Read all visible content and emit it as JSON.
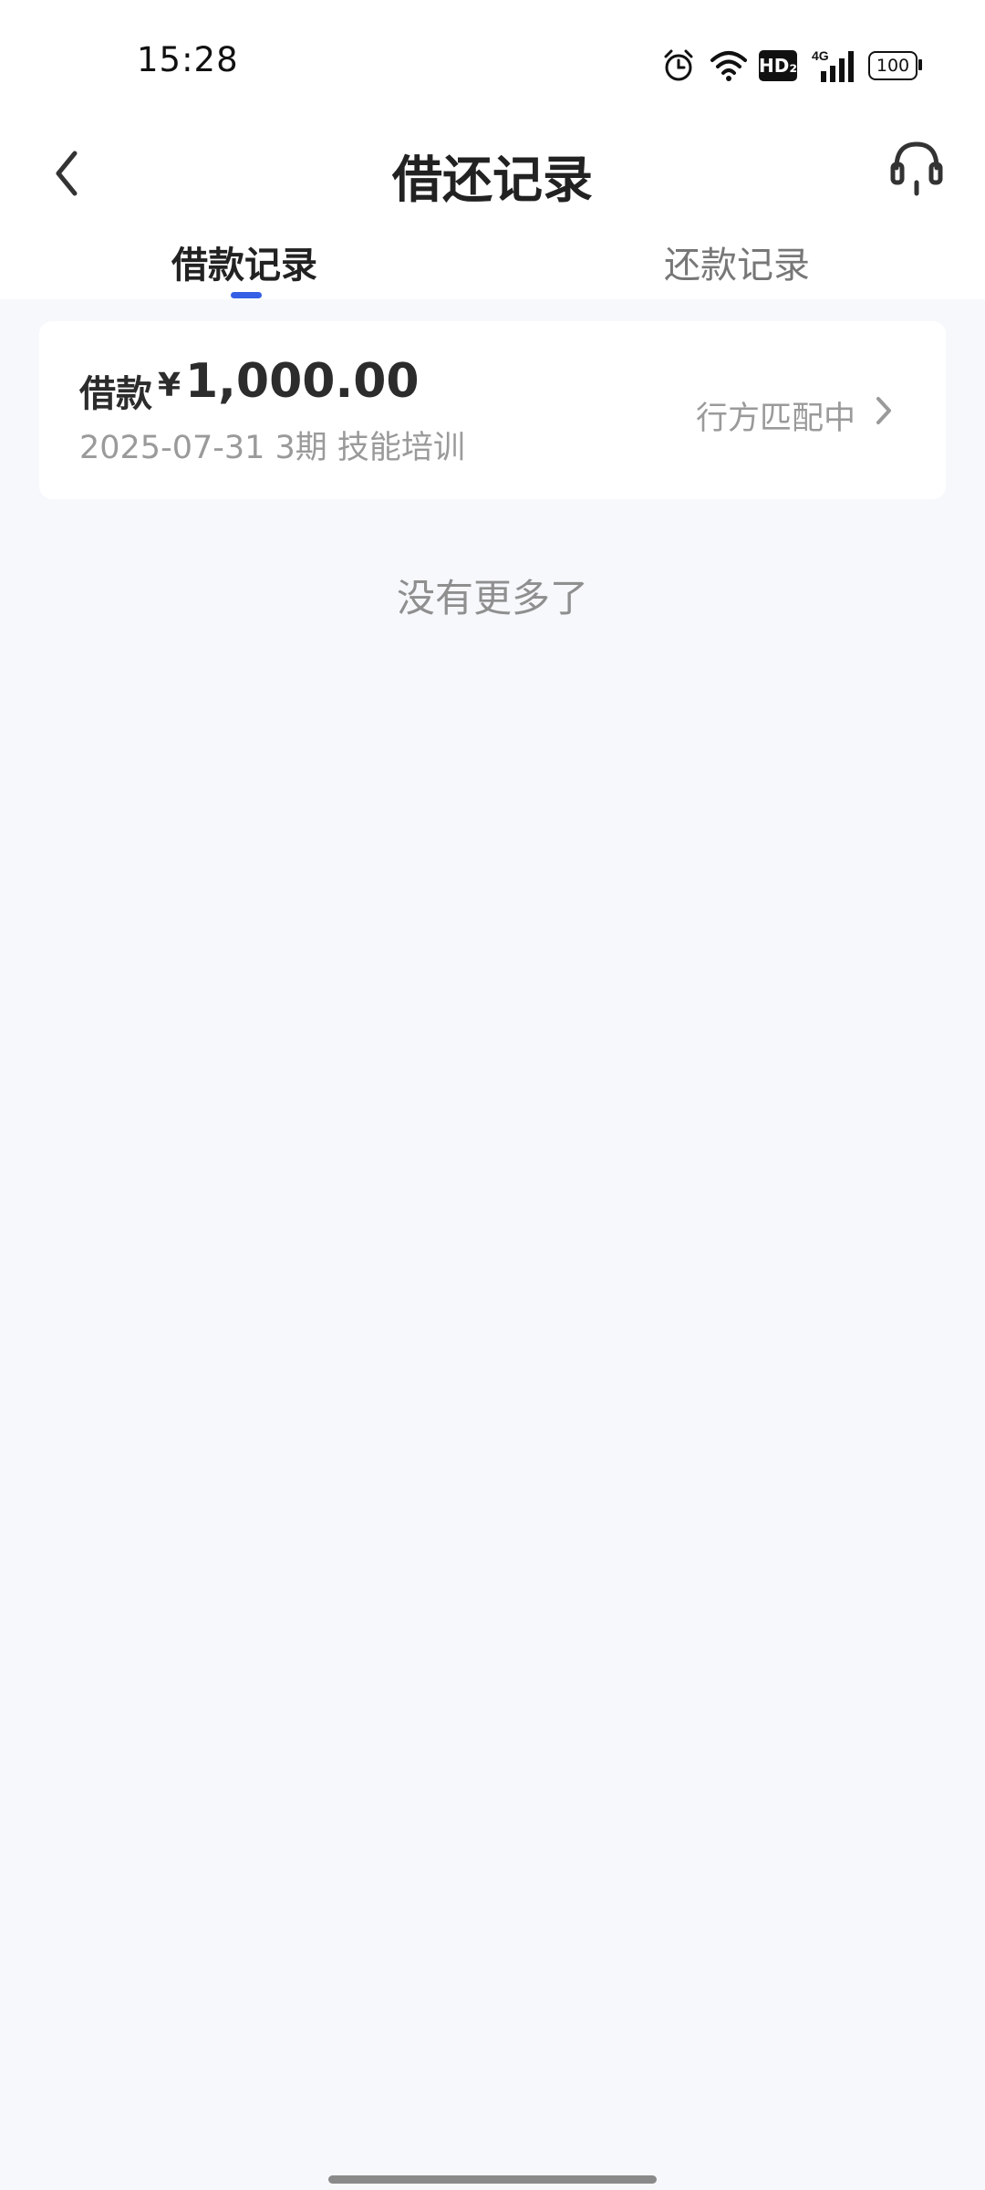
{
  "status_bar": {
    "time": "15:28",
    "network": "4G",
    "hd": "HD₂",
    "battery": "100"
  },
  "header": {
    "title": "借还记录"
  },
  "tabs": [
    {
      "label": "借款记录",
      "active": true
    },
    {
      "label": "还款记录",
      "active": false
    }
  ],
  "loan_card": {
    "label": "借款",
    "currency": "¥",
    "amount": "1,000.00",
    "meta": "2025-07-31 3期  技能培训",
    "status": "行方匹配中"
  },
  "footer_text": "没有更多了",
  "colors": {
    "accent": "#3560e5",
    "background": "#f6f8fc"
  }
}
